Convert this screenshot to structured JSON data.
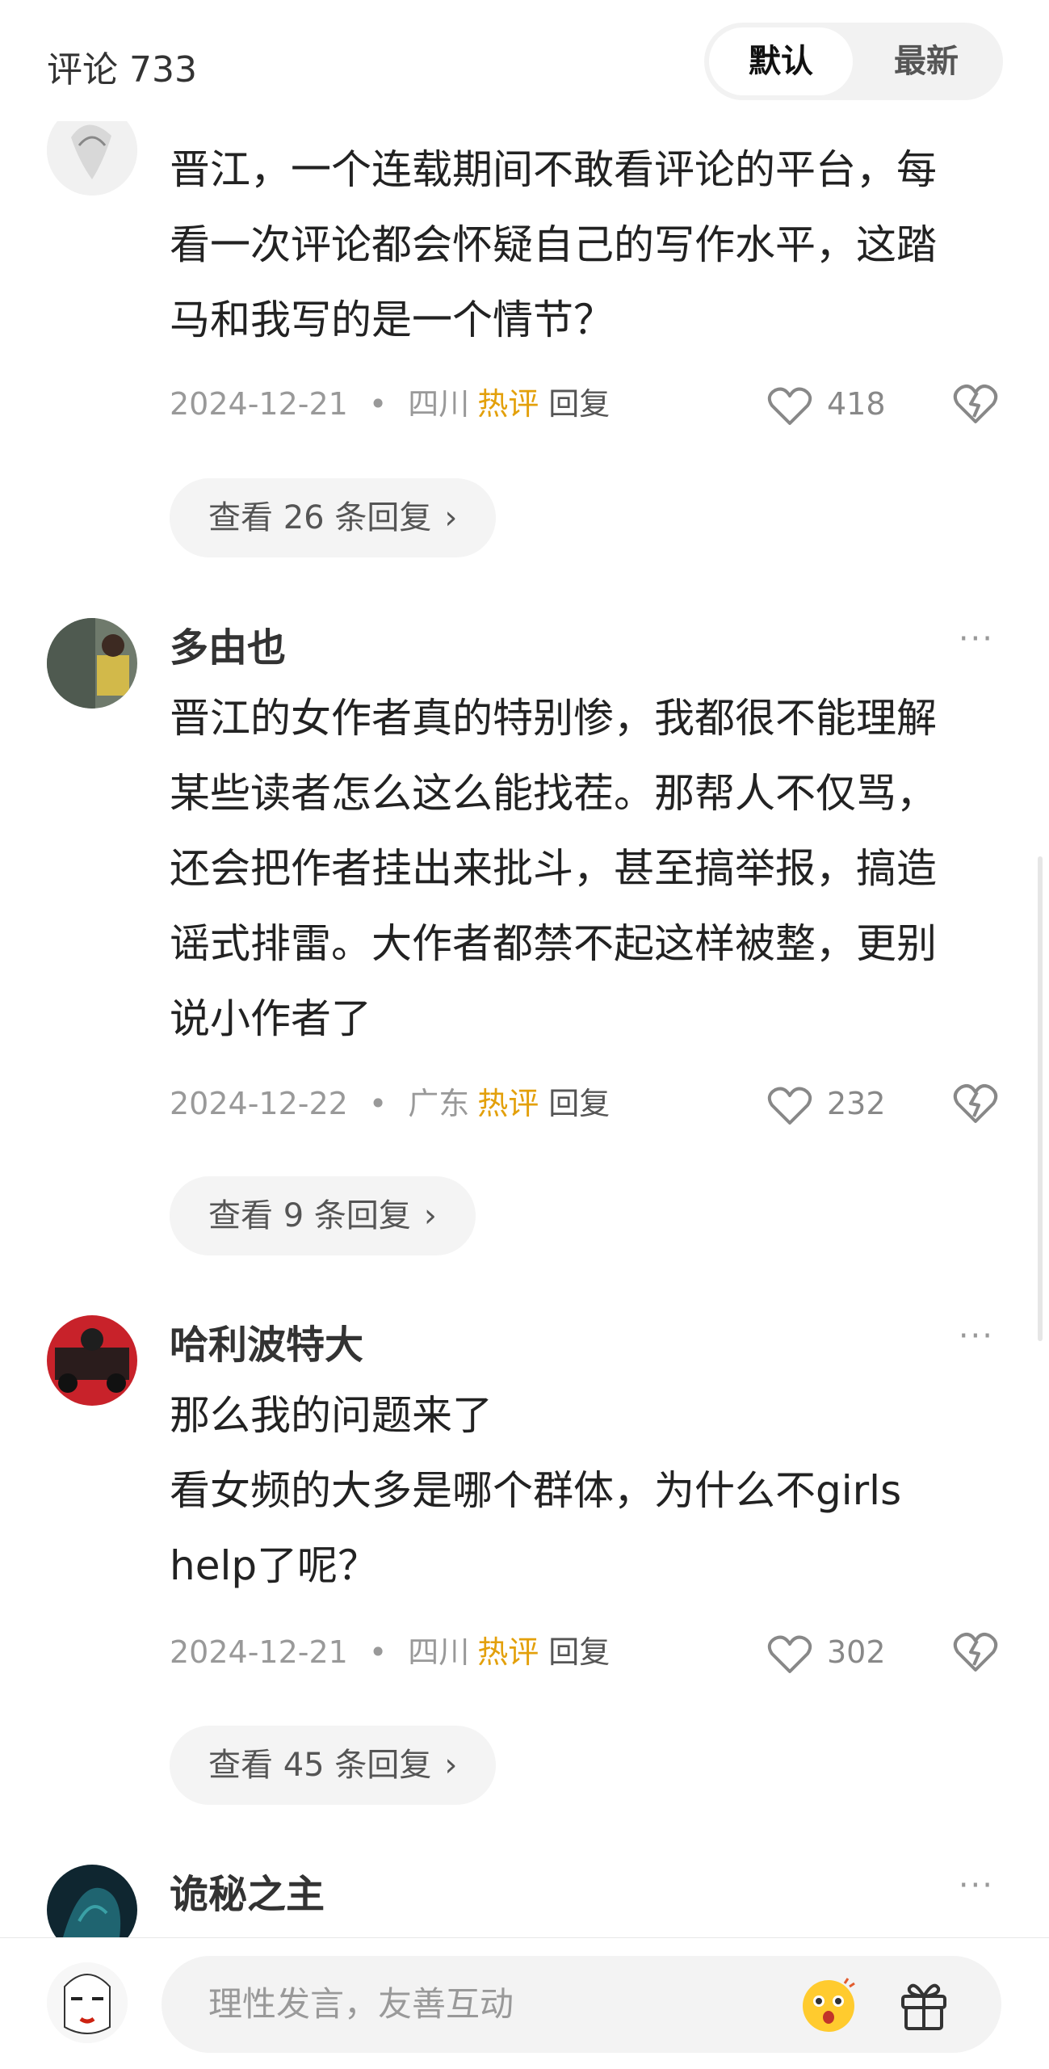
{
  "header": {
    "title": "评论 733",
    "tabs": [
      {
        "label": "默认",
        "active": true
      },
      {
        "label": "最新",
        "active": false
      }
    ]
  },
  "comments": [
    {
      "username": "",
      "text": "晋江，一个连载期间不敢看评论的平台，每\n看一次评论都会怀疑自己的写作水平，这踏\n马和我写的是一个情节？",
      "date": "2024-12-21",
      "location": "四川",
      "hot_label": "热评",
      "reply_label": "回复",
      "likes": "418",
      "view_replies": "查看 26 条回复"
    },
    {
      "username": "多由也",
      "more": "···",
      "text": "晋江的女作者真的特别惨，我都很不能理解\n某些读者怎么这么能找茬。那帮人不仅骂，\n还会把作者挂出来批斗，甚至搞举报，搞造\n谣式排雷。大作者都禁不起这样被整，更别\n说小作者了",
      "date": "2024-12-22",
      "location": "广东",
      "hot_label": "热评",
      "reply_label": "回复",
      "likes": "232",
      "view_replies": "查看 9 条回复"
    },
    {
      "username": "哈利波特大",
      "more": "···",
      "text": "那么我的问题来了\n看女频的大多是哪个群体，为什么不girls\nhelp了呢？",
      "date": "2024-12-21",
      "location": "四川",
      "hot_label": "热评",
      "reply_label": "回复",
      "likes": "302",
      "view_replies": "查看 45 条回复"
    },
    {
      "username": "诡秘之主",
      "more": "···"
    }
  ],
  "meta_separator": "•",
  "reply_arrow": "›",
  "icons": {
    "like": "heart-outline-icon",
    "dislike": "broken-heart-icon",
    "emoji": "emoji-face-icon",
    "gift": "gift-icon"
  },
  "colors": {
    "hot": "#e3a00b",
    "muted": "#999999"
  },
  "input": {
    "placeholder": "理性发言，友善互动"
  }
}
